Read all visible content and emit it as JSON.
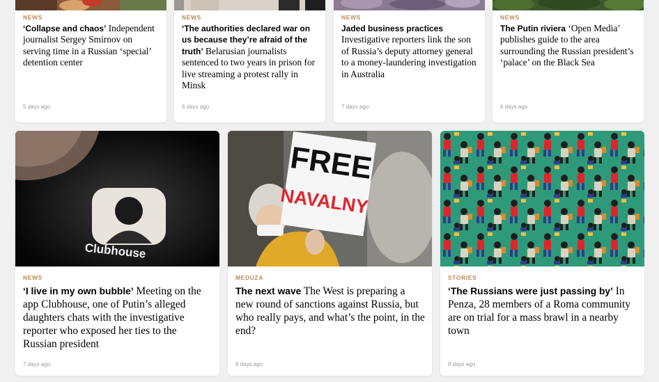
{
  "top_cards": [
    {
      "tag": "NEWS",
      "lead": "‘Collapse and chaos’",
      "rest": " Independent journalist Sergey Smirnov on serving time in a Russian ‘special’ detention center",
      "date": "5 days ago"
    },
    {
      "tag": "NEWS",
      "lead": "‘The authorities declared war on us because they’re afraid of the truth’",
      "rest": " Belarusian journalists sentenced to two years in prison for live streaming a protest rally in Minsk",
      "date": "6 days ago"
    },
    {
      "tag": "NEWS",
      "lead": "Jaded business practices",
      "rest": " Investigative reporters link the son of Russia’s deputy attorney general to a money-laundering investigation in Australia",
      "date": "7 days ago"
    },
    {
      "tag": "NEWS",
      "lead": "The Putin riviera",
      "rest": " ‘Open Media’ publishes guide to the area surrounding the Russian president’s ‘palace’ on the Black Sea",
      "date": "6 days ago"
    }
  ],
  "bottom_cards": [
    {
      "tag": "NEWS",
      "lead": "‘I live in my own bubble’",
      "rest": " Meeting on the app Clubhouse, one of Putin’s alleged daughters chats with the investigative reporter who exposed her ties to the Russian president",
      "date": "7 days ago",
      "image_text": "Clubhouse"
    },
    {
      "tag": "MEDUZA",
      "lead": "The next wave",
      "rest": " The West is preparing a new round of sanctions against Russia, but who really pays, and what’s the point, in the end?",
      "date": "8 days ago",
      "sign_line1": "FREE",
      "sign_line2": "NAVALNY"
    },
    {
      "tag": "STORIES",
      "lead": "‘The Russians were just passing by’",
      "rest": " In Penza, 28 members of a Roma community are on trial for a mass brawl in a nearby town",
      "date": "8 days ago"
    }
  ],
  "colors": {
    "tag": "#b88b58",
    "background": "#f0f0f0",
    "card": "#ffffff",
    "date": "#999999",
    "pattern_bg": "#2f9a7a",
    "sign_red": "#e0242c"
  }
}
